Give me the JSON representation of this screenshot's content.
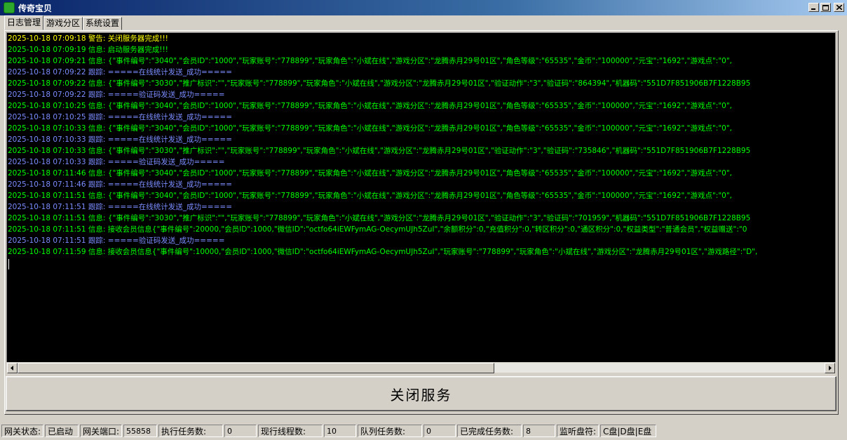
{
  "window": {
    "title": "传奇宝贝",
    "icon": "app-icon"
  },
  "tabs": [
    {
      "label": "日志管理"
    },
    {
      "label": "游戏分区"
    },
    {
      "label": "系统设置"
    }
  ],
  "log": [
    {
      "ts": "2025-10-18 07:09:18",
      "level": "警告:",
      "msg": "关闭服务器完成!!!",
      "type": "warn"
    },
    {
      "ts": "2025-10-18 07:09:19",
      "level": "信息:",
      "msg": "启动服务器完成!!!",
      "type": "info"
    },
    {
      "ts": "2025-10-18 07:09:21",
      "level": "信息:",
      "msg": "{\"事件编号\":\"3040\",\"会员ID\":\"1000\",\"玩家账号\":\"778899\",\"玩家角色\":\"小斌在线\",\"游戏分区\":\"龙腾赤月29号01区\",\"角色等级\":\"65535\",\"金币\":\"100000\",\"元宝\":\"1692\",\"游戏点\":\"0\",",
      "type": "info"
    },
    {
      "ts": "2025-10-18 07:09:22",
      "level": "跟踪:",
      "msg": "=====在线统计发送_成功=====",
      "type": "trace"
    },
    {
      "ts": "2025-10-18 07:09:22",
      "level": "信息:",
      "msg": "{\"事件编号\":\"3030\",\"推广标识\":\"\",\"玩家账号\":\"778899\",\"玩家角色\":\"小斌在线\",\"游戏分区\":\"龙腾赤月29号01区\",\"验证动作\":\"3\",\"验证码\":\"864394\",\"机器码\":\"551D7F851906B7F1228B95",
      "type": "info"
    },
    {
      "ts": "2025-10-18 07:09:22",
      "level": "跟踪:",
      "msg": "=====验证码发送_成功=====",
      "type": "trace"
    },
    {
      "ts": "2025-10-18 07:10:25",
      "level": "信息:",
      "msg": "{\"事件编号\":\"3040\",\"会员ID\":\"1000\",\"玩家账号\":\"778899\",\"玩家角色\":\"小斌在线\",\"游戏分区\":\"龙腾赤月29号01区\",\"角色等级\":\"65535\",\"金币\":\"100000\",\"元宝\":\"1692\",\"游戏点\":\"0\",",
      "type": "info"
    },
    {
      "ts": "2025-10-18 07:10:25",
      "level": "跟踪:",
      "msg": "=====在线统计发送_成功=====",
      "type": "trace"
    },
    {
      "ts": "2025-10-18 07:10:33",
      "level": "信息:",
      "msg": "{\"事件编号\":\"3040\",\"会员ID\":\"1000\",\"玩家账号\":\"778899\",\"玩家角色\":\"小斌在线\",\"游戏分区\":\"龙腾赤月29号01区\",\"角色等级\":\"65535\",\"金币\":\"100000\",\"元宝\":\"1692\",\"游戏点\":\"0\",",
      "type": "info"
    },
    {
      "ts": "2025-10-18 07:10:33",
      "level": "跟踪:",
      "msg": "=====在线统计发送_成功=====",
      "type": "trace"
    },
    {
      "ts": "2025-10-18 07:10:33",
      "level": "信息:",
      "msg": "{\"事件编号\":\"3030\",\"推广标识\":\"\",\"玩家账号\":\"778899\",\"玩家角色\":\"小斌在线\",\"游戏分区\":\"龙腾赤月29号01区\",\"验证动作\":\"3\",\"验证码\":\"735846\",\"机器码\":\"551D7F851906B7F1228B95",
      "type": "info"
    },
    {
      "ts": "2025-10-18 07:10:33",
      "level": "跟踪:",
      "msg": "=====验证码发送_成功=====",
      "type": "trace"
    },
    {
      "ts": "2025-10-18 07:11:46",
      "level": "信息:",
      "msg": "{\"事件编号\":\"3040\",\"会员ID\":\"1000\",\"玩家账号\":\"778899\",\"玩家角色\":\"小斌在线\",\"游戏分区\":\"龙腾赤月29号01区\",\"角色等级\":\"65535\",\"金币\":\"100000\",\"元宝\":\"1692\",\"游戏点\":\"0\",",
      "type": "info"
    },
    {
      "ts": "2025-10-18 07:11:46",
      "level": "跟踪:",
      "msg": "=====在线统计发送_成功=====",
      "type": "trace"
    },
    {
      "ts": "2025-10-18 07:11:51",
      "level": "信息:",
      "msg": "{\"事件编号\":\"3040\",\"会员ID\":\"1000\",\"玩家账号\":\"778899\",\"玩家角色\":\"小斌在线\",\"游戏分区\":\"龙腾赤月29号01区\",\"角色等级\":\"65535\",\"金币\":\"100000\",\"元宝\":\"1692\",\"游戏点\":\"0\",",
      "type": "info"
    },
    {
      "ts": "2025-10-18 07:11:51",
      "level": "跟踪:",
      "msg": "=====在线统计发送_成功=====",
      "type": "trace"
    },
    {
      "ts": "2025-10-18 07:11:51",
      "level": "信息:",
      "msg": "{\"事件编号\":\"3030\",\"推广标识\":\"\",\"玩家账号\":\"778899\",\"玩家角色\":\"小斌在线\",\"游戏分区\":\"龙腾赤月29号01区\",\"验证动作\":\"3\",\"验证码\":\"701959\",\"机器码\":\"551D7F851906B7F1228B95",
      "type": "info"
    },
    {
      "ts": "2025-10-18 07:11:51",
      "level": "信息:",
      "msg": "接收会员信息{\"事件编号\":20000,\"会员ID\":1000,\"微信ID\":\"octfo64iEWFymAG-OecymUJh5ZuI\",\"余额积分\":0,\"充值积分\":0,\"转区积分\":0,\"通区积分\":0,\"权益类型\":\"普通会员\",\"权益赠送\":\"0",
      "type": "info"
    },
    {
      "ts": "2025-10-18 07:11:51",
      "level": "跟踪:",
      "msg": "=====验证码发送_成功=====",
      "type": "trace"
    },
    {
      "ts": "2025-10-18 07:11:59",
      "level": "信息:",
      "msg": "接收会员信息{\"事件编号\":10000,\"会员ID\":1000,\"微信ID\":\"octfo64iEWFymAG-OecymUJh5ZuI\",\"玩家账号\":\"778899\",\"玩家角色\":\"小斌在线\",\"游戏分区\":\"龙腾赤月29号01区\",\"游戏路径\":\"D\",",
      "type": "info"
    }
  ],
  "colors": {
    "warn": "#ffff00",
    "info": "#00ff00",
    "trace": "#7a8cff",
    "console_bg": "#000000"
  },
  "close_button": {
    "label": "关闭服务"
  },
  "status": [
    {
      "label": "网关状态:",
      "value": "已启动"
    },
    {
      "label": "网关端口:",
      "value": "55858"
    },
    {
      "label": "执行任务数:",
      "value": "0"
    },
    {
      "label": "现行线程数:",
      "value": "10"
    },
    {
      "label": "队列任务数:",
      "value": "0"
    },
    {
      "label": "已完成任务数:",
      "value": "8"
    },
    {
      "label": "监听盘符:",
      "value": "C盘|D盘|E盘"
    }
  ]
}
